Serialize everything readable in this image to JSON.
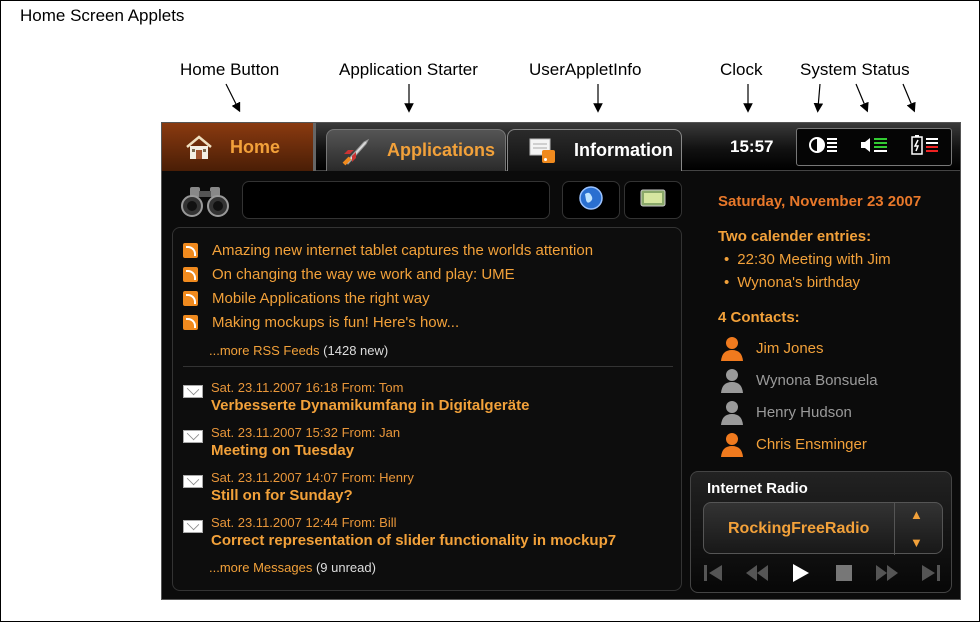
{
  "page_title": "Home Screen Applets",
  "annotations": {
    "home_button": "Home Button",
    "app_starter": "Application Starter",
    "user_applet": "UserAppletInfo",
    "clock": "Clock",
    "system_status": "System Status"
  },
  "topbar": {
    "home_label": "Home",
    "apps_label": "Applications",
    "info_label": "Information",
    "clock": "15:57"
  },
  "rss": {
    "items": [
      "Amazing new internet tablet captures the worlds attention",
      "On changing the way we work and play: UME",
      "Mobile Applications the right way",
      "Making mockups is fun! Here's how..."
    ],
    "more_link": "...more RSS Feeds",
    "more_count": "(1428 new)"
  },
  "messages": {
    "items": [
      {
        "meta": "Sat. 23.11.2007 16:18  From: Tom",
        "subject": "Verbesserte Dynamikumfang in Digitalgeräte"
      },
      {
        "meta": "Sat. 23.11.2007 15:32  From: Jan",
        "subject": "Meeting on Tuesday"
      },
      {
        "meta": "Sat. 23.11.2007 14:07  From: Henry",
        "subject": "Still on for Sunday?"
      },
      {
        "meta": "Sat. 23.11.2007 12:44  From: Bill",
        "subject": "Correct representation of slider functionality in mockup7"
      }
    ],
    "more_link": "...more Messages",
    "more_count": "(9 unread)"
  },
  "info": {
    "date": "Saturday,  November 23 2007",
    "calendar_title": "Two calender entries:",
    "calendar": [
      "22:30 Meeting with Jim",
      "Wynona's birthday"
    ],
    "contacts_title": "4 Contacts:",
    "contacts": [
      {
        "name": "Jim Jones",
        "online": true
      },
      {
        "name": "Wynona Bonsuela",
        "online": false
      },
      {
        "name": "Henry Hudson",
        "online": false
      },
      {
        "name": "Chris Ensminger",
        "online": true
      }
    ]
  },
  "radio": {
    "title": "Internet Radio",
    "station": "RockingFreeRadio"
  },
  "colors": {
    "accent": "#f2a13a",
    "online": "#f07a1e",
    "offline": "#9a9a9a"
  }
}
